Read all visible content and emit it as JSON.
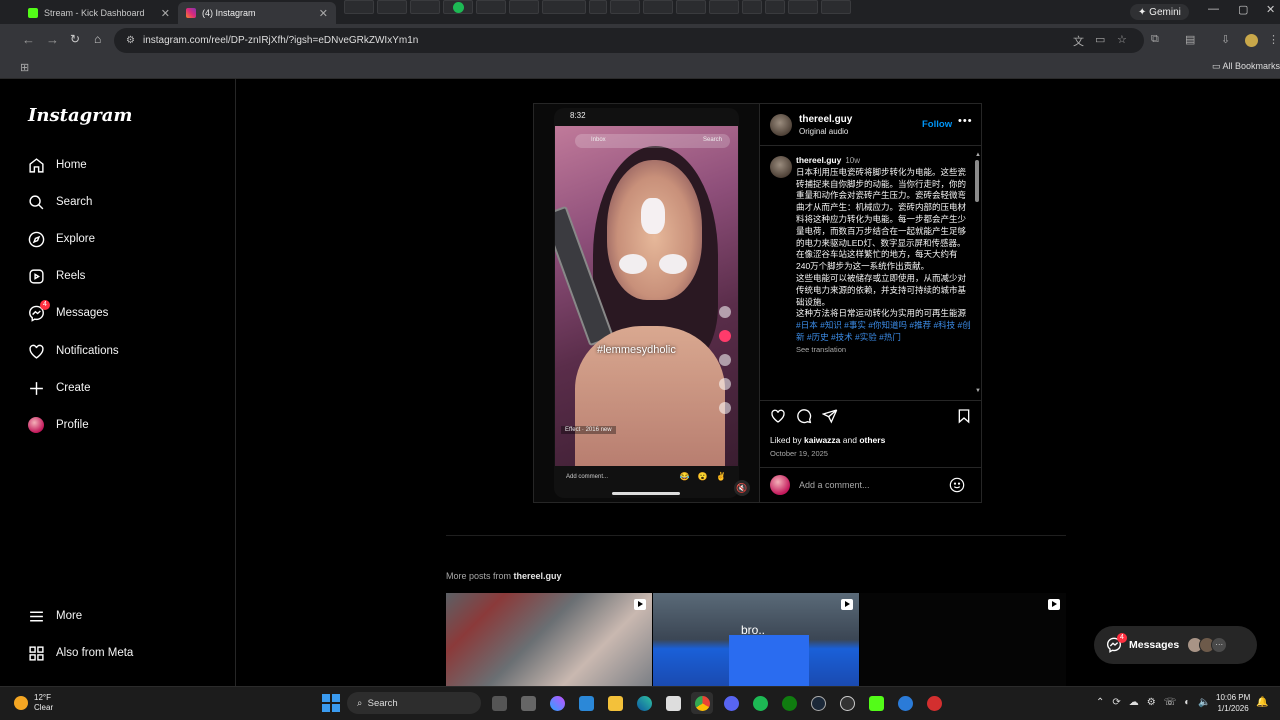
{
  "browser": {
    "tabs": [
      {
        "title": "Stream - Kick Dashboard",
        "favicon_color": "#53fc18"
      },
      {
        "title": "(4) Instagram",
        "favicon_color": "#e1306c"
      }
    ],
    "url": "instagram.com/reel/DP-znIRjXfh/?igsh=eDNveGRkZWIxYm1n",
    "gemini_label": "Gemini",
    "bookmarks_label": "All Bookmarks"
  },
  "sidebar": {
    "logo": "Instagram",
    "items": [
      {
        "label": "Home",
        "icon": "home-icon"
      },
      {
        "label": "Search",
        "icon": "search-icon"
      },
      {
        "label": "Explore",
        "icon": "compass-icon"
      },
      {
        "label": "Reels",
        "icon": "reels-icon"
      },
      {
        "label": "Messages",
        "icon": "messenger-icon",
        "badge": "4"
      },
      {
        "label": "Notifications",
        "icon": "heart-icon"
      },
      {
        "label": "Create",
        "icon": "plus-icon"
      },
      {
        "label": "Profile",
        "icon": "avatar"
      }
    ],
    "more": "More",
    "also_from_meta": "Also from Meta"
  },
  "post": {
    "video": {
      "status_time": "8:32",
      "search_placeholder": "Inbox",
      "search_action": "Search",
      "hashtag_overlay": "#lemmesydholic",
      "effect_label": "Effect · 2016 new",
      "comment_placeholder": "Add comment...",
      "emojis": "😂 😮 ✌"
    },
    "username": "thereel.guy",
    "audio": "Original audio",
    "follow": "Follow",
    "caption": {
      "username": "thereel.guy",
      "age": "10w",
      "text": "日本利用压电瓷砖将脚步转化为电能。这些瓷砖捕捉来自你脚步的动能。当你行走时，你的重量和动作会对瓷砖产生压力。瓷砖会轻微弯曲才从而产生：机械应力。瓷砖内部的压电材料将这种应力转化为电能。每一步都会产生少量电荷，而数百万步结合在一起就能产生足够的电力来驱动LED灯、数字显示屏和传感器。在像涩谷车站这样繁忙的地方，每天大约有240万个脚步为这一系统作出贡献。",
      "text2": "这些电能可以被储存或立即使用，从而减少对传统电力来源的依赖，并支持可持续的城市基础设施。",
      "text3": "这种方法将日常运动转化为实用的可再生能源",
      "tags": " #日本 #知识 #事实 #你知道吗 #推荐 #科技 #创新 #历史 #技术 #实验 #热门",
      "see_translation": "See translation"
    },
    "liked_by_prefix": "Liked by ",
    "liked_by_user": "kaiwazza",
    "liked_by_and": " and ",
    "liked_by_others": "others",
    "date": "October 19, 2025",
    "comment_placeholder": "Add a comment..."
  },
  "more_posts": {
    "prefix": "More posts from ",
    "username": "thereel.guy",
    "thumb2_text": "bro.."
  },
  "floating_messages": {
    "label": "Messages",
    "badge": "4",
    "more": "···"
  },
  "taskbar": {
    "temperature": "12°F",
    "condition": "Clear",
    "search_label": "Search",
    "time": "10:06 PM",
    "date": "1/1/2026"
  }
}
